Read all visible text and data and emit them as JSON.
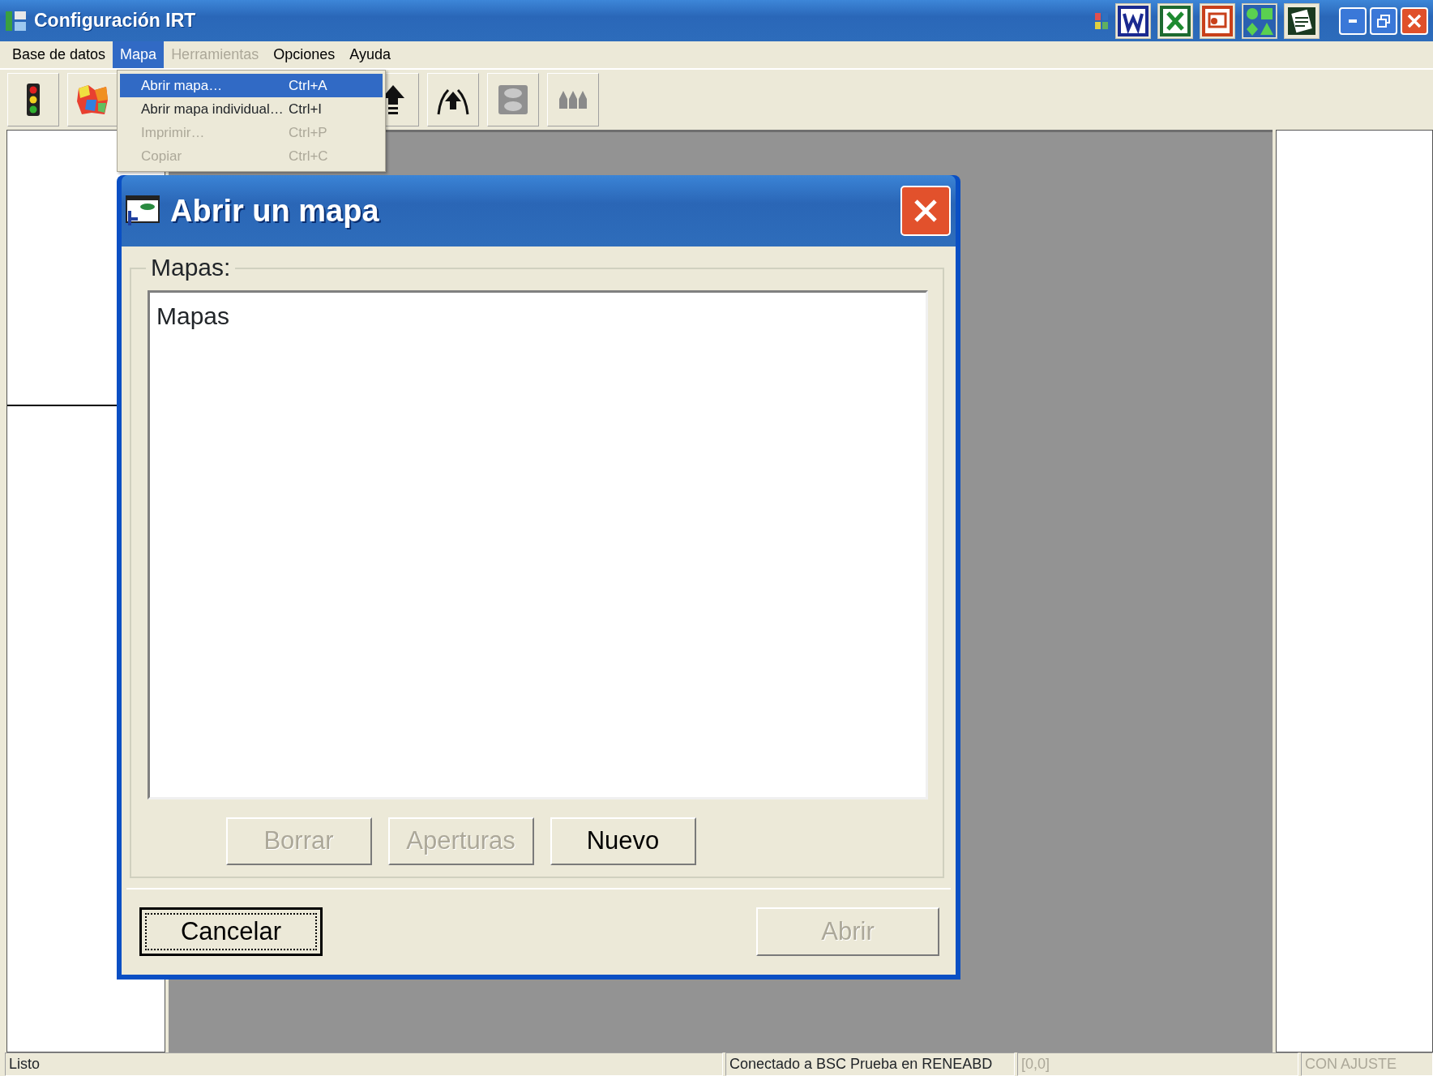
{
  "window": {
    "title": "Configuración IRT"
  },
  "menu": [
    {
      "label": "Base de datos",
      "selected": false,
      "disabled": false
    },
    {
      "label": "Mapa",
      "selected": true,
      "disabled": false
    },
    {
      "label": "Herramientas",
      "selected": false,
      "disabled": true
    },
    {
      "label": "Opciones",
      "selected": false,
      "disabled": false
    },
    {
      "label": "Ayuda",
      "selected": false,
      "disabled": false
    }
  ],
  "dropdown": [
    {
      "label": "Abrir mapa…",
      "shortcut": "Ctrl+A",
      "selected": true,
      "disabled": false
    },
    {
      "label": "Abrir mapa individual…",
      "shortcut": "Ctrl+I",
      "selected": false,
      "disabled": false
    },
    {
      "label": "Imprimir…",
      "shortcut": "Ctrl+P",
      "selected": false,
      "disabled": true
    },
    {
      "label": "Copiar",
      "shortcut": "Ctrl+C",
      "selected": false,
      "disabled": true
    }
  ],
  "dialog": {
    "title": "Abrir un mapa",
    "group_label": "Mapas:",
    "list_items": [
      {
        "label": "Mapas"
      }
    ],
    "buttons": [
      {
        "label": "Borrar",
        "disabled": true
      },
      {
        "label": "Aperturas",
        "disabled": true
      },
      {
        "label": "Nuevo",
        "disabled": false
      }
    ],
    "footer_buttons": [
      {
        "label": "Cancelar",
        "disabled": false,
        "focused": true
      },
      {
        "label": "Abrir",
        "disabled": true,
        "focused": false
      }
    ]
  },
  "status_bar": [
    {
      "text": "Listo",
      "disabled": false
    },
    {
      "text": "Conectado a BSC  Prueba en RENEABD",
      "disabled": false
    },
    {
      "text": "[0,0]",
      "disabled": true
    },
    {
      "text": "CON AJUSTE",
      "disabled": true
    }
  ]
}
